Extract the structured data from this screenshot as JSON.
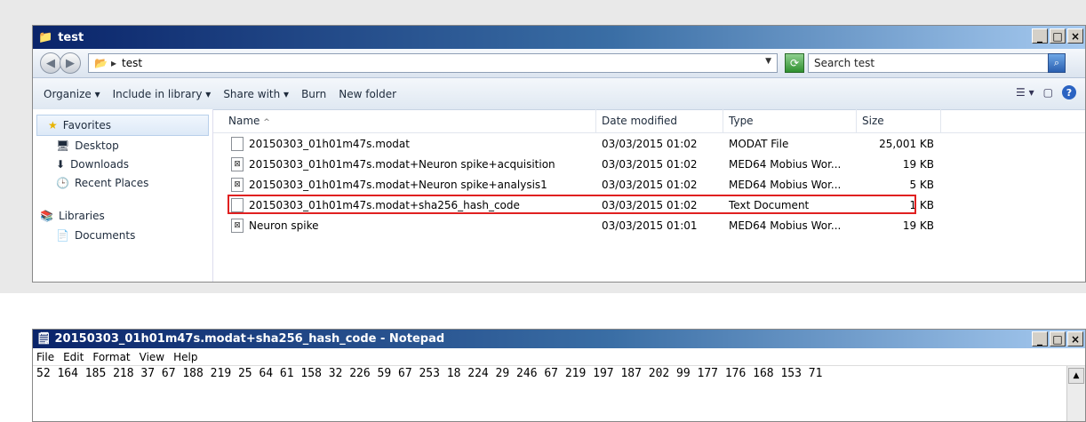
{
  "explorer": {
    "title": "test",
    "address": {
      "folder": "test"
    },
    "search_placeholder": "Search test",
    "toolbar": [
      "Organize ▾",
      "Include in library ▾",
      "Share with ▾",
      "Burn",
      "New folder"
    ],
    "nav": {
      "favorites": "Favorites",
      "favorite_items": [
        "Desktop",
        "Downloads",
        "Recent Places"
      ],
      "libraries": "Libraries",
      "library_items": [
        "Documents"
      ]
    },
    "columns": [
      "Name",
      "Date modified",
      "Type",
      "Size"
    ],
    "files": [
      {
        "name": "20150303_01h01m47s.modat",
        "date": "03/03/2015 01:02",
        "type": "MODAT File",
        "size": "25,001 KB",
        "icon": "blank-file-icon"
      },
      {
        "name": "20150303_01h01m47s.modat+Neuron spike+acquisition",
        "date": "03/03/2015 01:02",
        "type": "MED64 Mobius Wor...",
        "size": "19 KB",
        "icon": "mobius-file-icon"
      },
      {
        "name": "20150303_01h01m47s.modat+Neuron spike+analysis1",
        "date": "03/03/2015 01:02",
        "type": "MED64 Mobius Wor...",
        "size": "5 KB",
        "icon": "mobius-file-icon"
      },
      {
        "name": "20150303_01h01m47s.modat+sha256_hash_code",
        "date": "03/03/2015 01:02",
        "type": "Text Document",
        "size": "1 KB",
        "icon": "text-file-icon",
        "highlighted": true
      },
      {
        "name": "Neuron spike",
        "date": "03/03/2015 01:01",
        "type": "MED64 Mobius Wor...",
        "size": "19 KB",
        "icon": "mobius-file-icon"
      }
    ]
  },
  "notepad": {
    "title": "20150303_01h01m47s.modat+sha256_hash_code - Notepad",
    "menu": [
      "File",
      "Edit",
      "Format",
      "View",
      "Help"
    ],
    "content": "52 164 185 218 37 67 188 219 25 64 61 158 32 226 59 67 253 18 224 29 246 67 219 197 187 202 99 177 176 168 153 71"
  },
  "colors": {
    "highlight_border": "#e02020",
    "title_bar": "#0a246a"
  }
}
